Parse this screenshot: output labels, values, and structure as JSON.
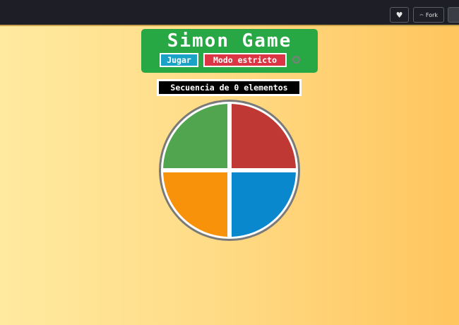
{
  "toolbar": {
    "heart_icon": "heart-icon",
    "fork_label": "Fork",
    "fork_icon": "fork-icon"
  },
  "game": {
    "title": "Simon Game",
    "play_label": "Jugar",
    "strict_label": "Modo estricto",
    "strict_led_color": "#2fa84a",
    "counter_text": "Secuencia de 0 elementos"
  },
  "pads": {
    "colors": {
      "green": "#52a54f",
      "red": "#c03833",
      "orange": "#f7920a",
      "blue": "#0a88ce"
    }
  },
  "colors": {
    "panel": "#28a745",
    "play_button": "#1aa3c7",
    "strict_button": "#dc3545",
    "topbar": "#1e1f26"
  }
}
